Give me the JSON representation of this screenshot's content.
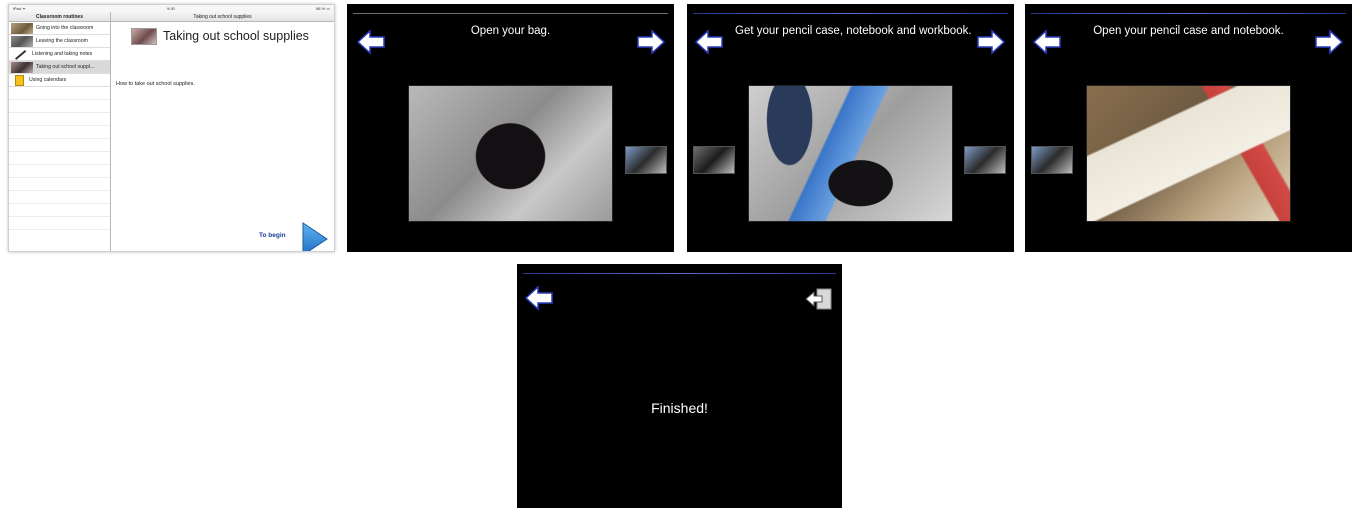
{
  "ipad": {
    "status_left": "iPad ᯤ",
    "status_time": "9:30",
    "status_right": "98 % ▭",
    "sidebar_title": "Classroom routines",
    "detail_header": "Taking out school supplies",
    "routines": [
      {
        "label": "Going into the classroom",
        "icon": "classroom-photo-thumbnail",
        "selected": false
      },
      {
        "label": "Leaving the classroom",
        "icon": "classroom-photo-thumbnail",
        "selected": false
      },
      {
        "label": "Listening and taking notes",
        "icon": "pencil-icon",
        "selected": false
      },
      {
        "label": "Taking out school suppl...",
        "icon": "school-supplies-thumbnail",
        "selected": true
      },
      {
        "label": "Using calendars",
        "icon": "notepad-icon",
        "selected": false
      }
    ],
    "detail_title": "Taking out school supplies",
    "detail_description": "How to take out school supplies.",
    "begin_label": "To begin",
    "accent_color": "#2f86d8"
  },
  "steps": [
    {
      "title": "Open your bag."
    },
    {
      "title": "Get your pencil case, notebook and workbook."
    },
    {
      "title": "Open your pencil case and notebook."
    }
  ],
  "finish": {
    "text": "Finished!"
  },
  "colors": {
    "player_background": "#000000",
    "arrow_fill": "#ffffff",
    "arrow_glow": "#2a3cc0"
  }
}
